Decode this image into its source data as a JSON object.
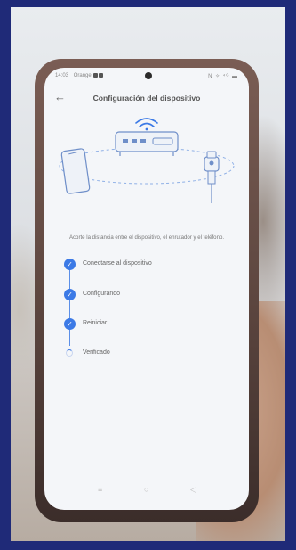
{
  "status_bar": {
    "time": "14:03",
    "carrier": "Orange",
    "right_icons": "N ✧ ⁴ᴳ ▬"
  },
  "header": {
    "title": "Configuración del dispositivo"
  },
  "hint_text": "Acorte la distancia entre el dispositivo, el enrutador y el teléfono.",
  "steps": [
    {
      "label": "Conectarse al dispositivo",
      "state": "done"
    },
    {
      "label": "Configurando",
      "state": "done"
    },
    {
      "label": "Reiniciar",
      "state": "done"
    },
    {
      "label": "Verificado",
      "state": "in-progress"
    }
  ],
  "nav": {
    "menu_glyph": "≡",
    "home_glyph": "○",
    "back_glyph": "◁"
  },
  "colors": {
    "accent": "#3c7ae6",
    "frame": "#1f2a78"
  }
}
